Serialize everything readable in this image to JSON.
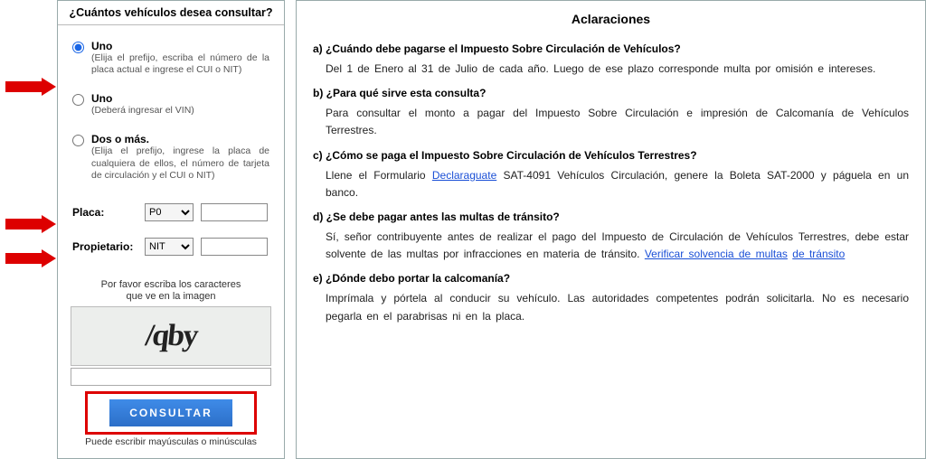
{
  "left": {
    "header": "¿Cuántos vehículos desea consultar?",
    "options": [
      {
        "title": "Uno",
        "desc": "(Elija el prefijo, escriba el número de la placa actual e ingrese el CUI o NIT)",
        "checked": true
      },
      {
        "title": "Uno",
        "desc": "(Deberá ingresar el VIN)",
        "checked": false
      },
      {
        "title": "Dos o más.",
        "desc": "(Elija el prefijo, ingrese la placa de cualquiera de ellos, el número de tarjeta de circulación y el CUI o NIT)",
        "checked": false
      }
    ],
    "placa_label": "Placa:",
    "placa_select": "P0",
    "placa_value": "",
    "prop_label": "Propietario:",
    "prop_select": "NIT",
    "prop_value": "",
    "captcha_prompt1": "Por favor escriba los caracteres",
    "captcha_prompt2": "que ve en la imagen",
    "captcha_text": "/qby",
    "consult_label": "CONSULTAR",
    "captcha_note": "Puede escribir mayúsculas o minúsculas"
  },
  "right": {
    "title": "Aclaraciones",
    "qa": [
      {
        "q": "a) ¿Cuándo debe pagarse el Impuesto Sobre Circulación de Vehículos?",
        "a": "Del 1 de Enero al 31 de Julio de cada año. Luego de ese plazo corresponde multa por omisión e intereses."
      },
      {
        "q": "b) ¿Para qué sirve esta consulta?",
        "a": "Para consultar el monto a pagar del Impuesto Sobre Circulación e impresión de Calcomanía de Vehículos Terrestres."
      },
      {
        "q": "c) ¿Cómo se paga el Impuesto Sobre Circulación de Vehículos Terrestres?",
        "a_pre": "Llene el Formulario ",
        "a_link": "Declaraguate",
        "a_post": " SAT-4091 Vehículos Circulación, genere la Boleta  SAT-2000 y páguela en un banco."
      },
      {
        "q": "d) ¿Se debe pagar antes las multas de tránsito?",
        "a_pre": "Sí, señor contribuyente antes de realizar el pago del Impuesto de Circulación de  Vehículos Terrestres, debe estar solvente de las multas por infracciones en materia de tránsito.  ",
        "a_link1": "Verificar solvencia de multas",
        "a_mid": "   ",
        "a_link2": "de tránsito"
      },
      {
        "q": "e) ¿Dónde debo portar la calcomanía?",
        "a": "Imprímala y pórtela al conducir su vehículo. Las autoridades competentes podrán solicitarla. No es necesario pegarla en el  parabrisas ni en la placa."
      }
    ]
  }
}
